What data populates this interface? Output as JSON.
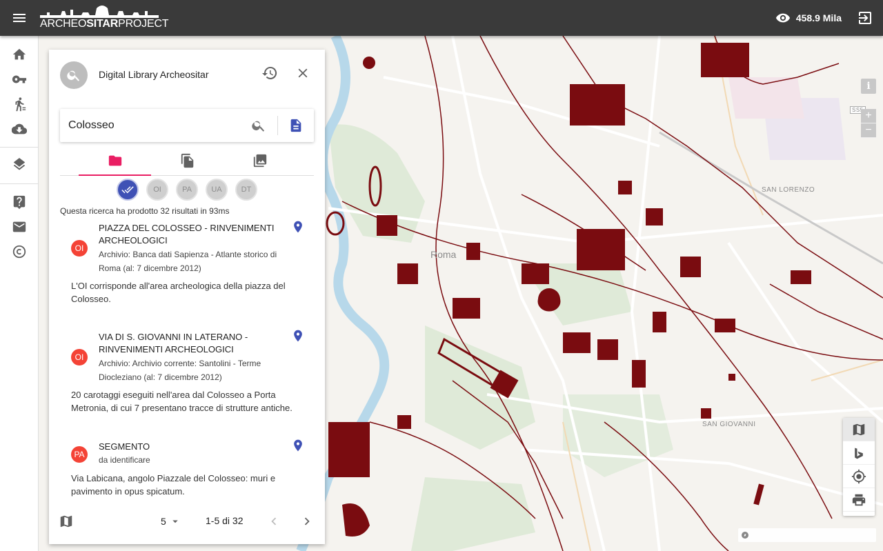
{
  "header": {
    "menu_icon": "menu-icon",
    "logo_part1": "ARCHEO",
    "logo_part2": "SITAR",
    "logo_part3": "PROJECT",
    "views_count": "458.9 Mila",
    "views_icon": "eye-icon",
    "logout_icon": "exit-icon"
  },
  "rail": {
    "items": [
      "home-icon",
      "key-icon",
      "walk-icon",
      "cloud-download-icon",
      "layers-icon",
      "help-icon",
      "mail-icon",
      "copyright-icon"
    ]
  },
  "map": {
    "city_label": "Roma",
    "district_labels": [
      "SAN LORENZO",
      "SAN GIOVANNI"
    ],
    "road_shield": "SS5",
    "controls": {
      "info": "i",
      "zoom_in": "+",
      "zoom_out": "−"
    },
    "tools": [
      "map-icon",
      "bing-icon",
      "locate-icon",
      "print-icon"
    ],
    "accent": "#7a0c10"
  },
  "panel": {
    "title": "Digital Library Archeositar",
    "search": {
      "value": "Colosseo",
      "placeholder": ""
    },
    "tabs": [
      "folder-icon",
      "documents-icon",
      "images-icon"
    ],
    "active_tab": 0,
    "filters": [
      "OI",
      "PA",
      "UA",
      "DT"
    ],
    "result_count_text": "Questa ricerca ha prodotto 32 risultati in 93ms",
    "results": [
      {
        "badge": "OI",
        "title": "PIAZZA DEL COLOSSEO - RINVENIMENTI ARCHEOLOGICI",
        "subtitle": "Archivio: Banca dati Sapienza - Atlante storico di Roma (al: 7 dicembre 2012)",
        "description": "L'OI corrisponde all'area archeologica della piazza del Colosseo."
      },
      {
        "badge": "OI",
        "title": "VIA DI S. GIOVANNI IN LATERANO - RINVENIMENTI ARCHEOLOGICI",
        "subtitle": "Archivio: Archivio corrente: Santolini - Terme Diocleziano (al: 7 dicembre 2012)",
        "description": "20 carotaggi eseguiti nell'area dal Colosseo a Porta Metronia, di cui 7 presentano tracce di strutture antiche."
      },
      {
        "badge": "PA",
        "title": "SEGMENTO",
        "subtitle": "da identificare",
        "description": "Via Labicana, angolo Piazzale del Colosseo: muri e pavimento in opus spicatum."
      }
    ],
    "pager": {
      "page_size": "5",
      "range": "1-5 di 32"
    },
    "colors": {
      "accent_pink": "#e91e63",
      "badge_red": "#f44336",
      "pin_blue": "#3f51b5"
    }
  }
}
